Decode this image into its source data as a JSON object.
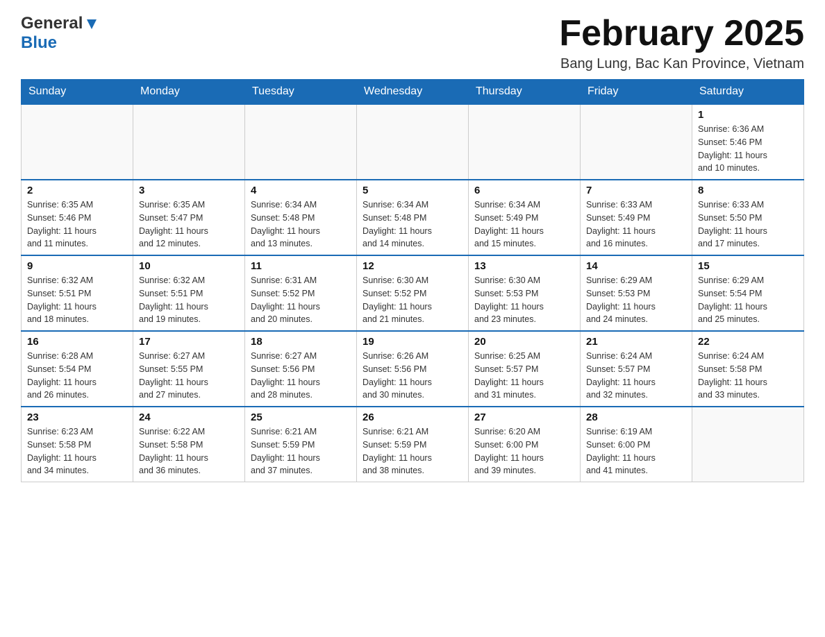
{
  "header": {
    "logo_line1": "General",
    "logo_line2": "Blue",
    "title": "February 2025",
    "subtitle": "Bang Lung, Bac Kan Province, Vietnam"
  },
  "days_of_week": [
    "Sunday",
    "Monday",
    "Tuesday",
    "Wednesday",
    "Thursday",
    "Friday",
    "Saturday"
  ],
  "weeks": [
    [
      {
        "day": "",
        "info": ""
      },
      {
        "day": "",
        "info": ""
      },
      {
        "day": "",
        "info": ""
      },
      {
        "day": "",
        "info": ""
      },
      {
        "day": "",
        "info": ""
      },
      {
        "day": "",
        "info": ""
      },
      {
        "day": "1",
        "info": "Sunrise: 6:36 AM\nSunset: 5:46 PM\nDaylight: 11 hours\nand 10 minutes."
      }
    ],
    [
      {
        "day": "2",
        "info": "Sunrise: 6:35 AM\nSunset: 5:46 PM\nDaylight: 11 hours\nand 11 minutes."
      },
      {
        "day": "3",
        "info": "Sunrise: 6:35 AM\nSunset: 5:47 PM\nDaylight: 11 hours\nand 12 minutes."
      },
      {
        "day": "4",
        "info": "Sunrise: 6:34 AM\nSunset: 5:48 PM\nDaylight: 11 hours\nand 13 minutes."
      },
      {
        "day": "5",
        "info": "Sunrise: 6:34 AM\nSunset: 5:48 PM\nDaylight: 11 hours\nand 14 minutes."
      },
      {
        "day": "6",
        "info": "Sunrise: 6:34 AM\nSunset: 5:49 PM\nDaylight: 11 hours\nand 15 minutes."
      },
      {
        "day": "7",
        "info": "Sunrise: 6:33 AM\nSunset: 5:49 PM\nDaylight: 11 hours\nand 16 minutes."
      },
      {
        "day": "8",
        "info": "Sunrise: 6:33 AM\nSunset: 5:50 PM\nDaylight: 11 hours\nand 17 minutes."
      }
    ],
    [
      {
        "day": "9",
        "info": "Sunrise: 6:32 AM\nSunset: 5:51 PM\nDaylight: 11 hours\nand 18 minutes."
      },
      {
        "day": "10",
        "info": "Sunrise: 6:32 AM\nSunset: 5:51 PM\nDaylight: 11 hours\nand 19 minutes."
      },
      {
        "day": "11",
        "info": "Sunrise: 6:31 AM\nSunset: 5:52 PM\nDaylight: 11 hours\nand 20 minutes."
      },
      {
        "day": "12",
        "info": "Sunrise: 6:30 AM\nSunset: 5:52 PM\nDaylight: 11 hours\nand 21 minutes."
      },
      {
        "day": "13",
        "info": "Sunrise: 6:30 AM\nSunset: 5:53 PM\nDaylight: 11 hours\nand 23 minutes."
      },
      {
        "day": "14",
        "info": "Sunrise: 6:29 AM\nSunset: 5:53 PM\nDaylight: 11 hours\nand 24 minutes."
      },
      {
        "day": "15",
        "info": "Sunrise: 6:29 AM\nSunset: 5:54 PM\nDaylight: 11 hours\nand 25 minutes."
      }
    ],
    [
      {
        "day": "16",
        "info": "Sunrise: 6:28 AM\nSunset: 5:54 PM\nDaylight: 11 hours\nand 26 minutes."
      },
      {
        "day": "17",
        "info": "Sunrise: 6:27 AM\nSunset: 5:55 PM\nDaylight: 11 hours\nand 27 minutes."
      },
      {
        "day": "18",
        "info": "Sunrise: 6:27 AM\nSunset: 5:56 PM\nDaylight: 11 hours\nand 28 minutes."
      },
      {
        "day": "19",
        "info": "Sunrise: 6:26 AM\nSunset: 5:56 PM\nDaylight: 11 hours\nand 30 minutes."
      },
      {
        "day": "20",
        "info": "Sunrise: 6:25 AM\nSunset: 5:57 PM\nDaylight: 11 hours\nand 31 minutes."
      },
      {
        "day": "21",
        "info": "Sunrise: 6:24 AM\nSunset: 5:57 PM\nDaylight: 11 hours\nand 32 minutes."
      },
      {
        "day": "22",
        "info": "Sunrise: 6:24 AM\nSunset: 5:58 PM\nDaylight: 11 hours\nand 33 minutes."
      }
    ],
    [
      {
        "day": "23",
        "info": "Sunrise: 6:23 AM\nSunset: 5:58 PM\nDaylight: 11 hours\nand 34 minutes."
      },
      {
        "day": "24",
        "info": "Sunrise: 6:22 AM\nSunset: 5:58 PM\nDaylight: 11 hours\nand 36 minutes."
      },
      {
        "day": "25",
        "info": "Sunrise: 6:21 AM\nSunset: 5:59 PM\nDaylight: 11 hours\nand 37 minutes."
      },
      {
        "day": "26",
        "info": "Sunrise: 6:21 AM\nSunset: 5:59 PM\nDaylight: 11 hours\nand 38 minutes."
      },
      {
        "day": "27",
        "info": "Sunrise: 6:20 AM\nSunset: 6:00 PM\nDaylight: 11 hours\nand 39 minutes."
      },
      {
        "day": "28",
        "info": "Sunrise: 6:19 AM\nSunset: 6:00 PM\nDaylight: 11 hours\nand 41 minutes."
      },
      {
        "day": "",
        "info": ""
      }
    ]
  ]
}
